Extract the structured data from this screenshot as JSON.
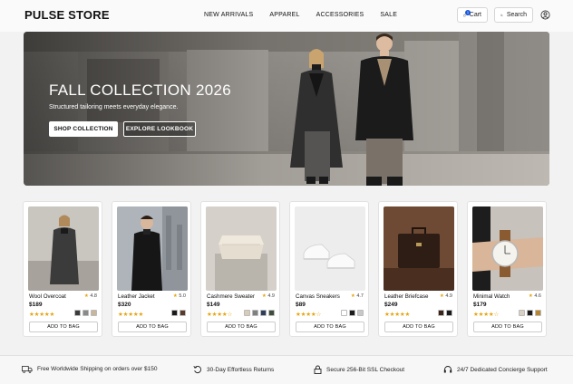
{
  "header": {
    "logo": "PULSE STORE",
    "nav": [
      "NEW ARRIVALS",
      "APPAREL",
      "ACCESSORIES",
      "SALE"
    ],
    "cart_label": "Cart",
    "cart_count": "1",
    "search_label": "Search"
  },
  "hero": {
    "title": "FALL COLLECTION 2026",
    "subtitle": "Structured tailoring meets everyday elegance.",
    "primary_button": "SHOP COLLECTION",
    "secondary_button": "EXPLORE LOOKBOOK"
  },
  "products": [
    {
      "name": "Wool Overcoat",
      "price": "$189",
      "rating": "4.8",
      "stars": "★★★★★",
      "swatches": [
        "#3a3a3a",
        "#8a8a8a",
        "#c8b79a"
      ],
      "add_label": "ADD TO BAG"
    },
    {
      "name": "Leather Jacket",
      "price": "$320",
      "rating": "5.0",
      "stars": "★★★★★",
      "swatches": [
        "#1a1a1a",
        "#5a3a2a"
      ],
      "add_label": "ADD TO BAG"
    },
    {
      "name": "Cashmere Sweater",
      "price": "$149",
      "rating": "4.9",
      "stars": "★★★★☆",
      "swatches": [
        "#d8ccb8",
        "#808080",
        "#2d3e5c",
        "#3e4e3a"
      ],
      "add_label": "ADD TO BAG"
    },
    {
      "name": "Canvas Sneakers",
      "price": "$89",
      "rating": "4.7",
      "stars": "★★★★☆",
      "swatches": [
        "#ffffff",
        "#1a1a1a",
        "#c8c8c8"
      ],
      "add_label": "ADD TO BAG"
    },
    {
      "name": "Leather Briefcase",
      "price": "$249",
      "rating": "4.9",
      "stars": "★★★★★",
      "swatches": [
        "#3a2418",
        "#1a1a1a"
      ],
      "add_label": "ADD TO BAG"
    },
    {
      "name": "Minimal Watch",
      "price": "$179",
      "rating": "4.6",
      "stars": "★★★★☆",
      "swatches": [
        "#d8d0c0",
        "#1a1a1a",
        "#b8862e"
      ],
      "add_label": "ADD TO BAG"
    }
  ],
  "footer": {
    "features": [
      {
        "icon": "truck-icon",
        "text": "Free Worldwide Shipping on orders over $150"
      },
      {
        "icon": "returns-icon",
        "text": "30-Day Effortless Returns"
      },
      {
        "icon": "lock-icon",
        "text": "Secure 256-Bit SSL Checkout"
      },
      {
        "icon": "headset-icon",
        "text": "24/7 Dedicated Concierge Support"
      }
    ]
  },
  "colors": {
    "accent": "#1a56db",
    "star": "#e5a40f",
    "text": "#111111"
  }
}
